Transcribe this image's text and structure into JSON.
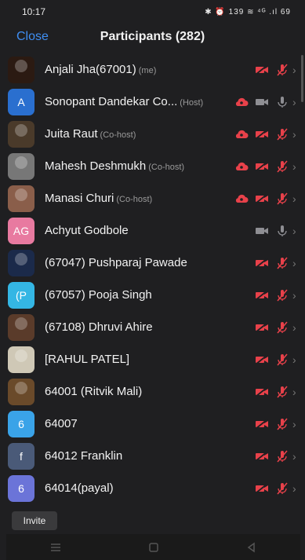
{
  "status": {
    "time": "10:17",
    "indicators": "✱ ⏰ 139 ≋ ⁴ᴳ .ıl 69"
  },
  "header": {
    "close_label": "Close",
    "title": "Participants (282)"
  },
  "participants": [
    {
      "name": "Anjali Jha(67001)",
      "role": "(me)",
      "avatar": {
        "type": "photo",
        "color": "#2b1a12"
      },
      "recording": false,
      "video": "off",
      "audio": "muted"
    },
    {
      "name": "Sonopant Dandekar Co...",
      "role": "(Host)",
      "avatar": {
        "type": "initial",
        "text": "A",
        "color": "#2a6fcf"
      },
      "recording": true,
      "video": "gray",
      "audio": "gray"
    },
    {
      "name": "Juita Raut",
      "role": "(Co-host)",
      "avatar": {
        "type": "photo",
        "color": "#4a3a2a"
      },
      "recording": true,
      "video": "off",
      "audio": "muted"
    },
    {
      "name": "Mahesh Deshmukh",
      "role": "(Co-host)",
      "avatar": {
        "type": "photo",
        "color": "#777777"
      },
      "recording": true,
      "video": "off",
      "audio": "muted"
    },
    {
      "name": "Manasi Churi",
      "role": "(Co-host)",
      "avatar": {
        "type": "photo",
        "color": "#8a5e4a"
      },
      "recording": true,
      "video": "off",
      "audio": "muted"
    },
    {
      "name": "Achyut Godbole",
      "role": "",
      "avatar": {
        "type": "initial",
        "text": "AG",
        "color": "#e87aa0"
      },
      "recording": false,
      "video": "gray",
      "audio": "gray"
    },
    {
      "name": "(67047) Pushparaj Pawade",
      "role": "",
      "avatar": {
        "type": "photo",
        "color": "#1b2a4a"
      },
      "recording": false,
      "video": "off",
      "audio": "muted"
    },
    {
      "name": "(67057) Pooja Singh",
      "role": "",
      "avatar": {
        "type": "initial",
        "text": "(P",
        "color": "#34b6e4"
      },
      "recording": false,
      "video": "off",
      "audio": "muted"
    },
    {
      "name": "(67108) Dhruvi Ahire",
      "role": "",
      "avatar": {
        "type": "photo",
        "color": "#5a3b2a"
      },
      "recording": false,
      "video": "off",
      "audio": "muted"
    },
    {
      "name": "[RAHUL PATEL]",
      "role": "",
      "avatar": {
        "type": "photo",
        "color": "#cfc8b6"
      },
      "recording": false,
      "video": "off",
      "audio": "muted"
    },
    {
      "name": "64001 (Ritvik Mali)",
      "role": "",
      "avatar": {
        "type": "photo",
        "color": "#6a4a2a"
      },
      "recording": false,
      "video": "off",
      "audio": "muted"
    },
    {
      "name": "64007",
      "role": "",
      "avatar": {
        "type": "initial",
        "text": "6",
        "color": "#3aa3e8"
      },
      "recording": false,
      "video": "off",
      "audio": "muted"
    },
    {
      "name": "64012 Franklin",
      "role": "",
      "avatar": {
        "type": "initial",
        "text": "f",
        "color": "#4a5a78"
      },
      "recording": false,
      "video": "off",
      "audio": "muted"
    },
    {
      "name": "64014(payal)",
      "role": "",
      "avatar": {
        "type": "initial",
        "text": "6",
        "color": "#6b74d8"
      },
      "recording": false,
      "video": "off",
      "audio": "muted"
    }
  ],
  "footer": {
    "invite_label": "Invite"
  },
  "colors": {
    "accent": "#3f8ef2",
    "muted_red": "#e8414a",
    "icon_gray": "#8e8e93"
  }
}
